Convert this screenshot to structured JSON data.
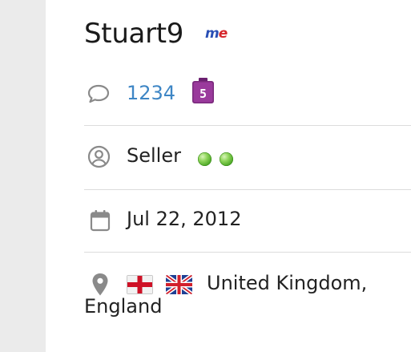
{
  "profile": {
    "username": "Stuart9",
    "me_badge": {
      "m": "m",
      "e": "e",
      "icon": "me-badge-icon"
    },
    "messages": {
      "icon": "speech-bubble-icon",
      "count": "1234",
      "level_badge_number": "5",
      "level_badge_color": "#7b2a7d"
    },
    "role": {
      "icon": "user-circle-icon",
      "label": "Seller",
      "status_dots": 2,
      "dot_color": "#5cb42e"
    },
    "joined": {
      "icon": "calendar-icon",
      "date": "Jul 22, 2012"
    },
    "location": {
      "icon": "map-pin-icon",
      "flags": [
        "england-flag",
        "uk-flag"
      ],
      "line1": "United Kingdom,",
      "line2": "England"
    }
  },
  "colors": {
    "link": "#3e86c5",
    "divider": "#dcdcdc",
    "rail": "#ebebeb",
    "icon_gray": "#8a8a8a"
  }
}
